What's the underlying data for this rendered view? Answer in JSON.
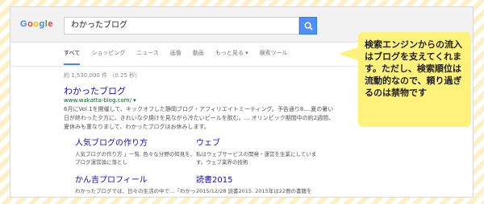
{
  "search": {
    "logo_text": "Google",
    "query": "わかったブログ"
  },
  "tabs": [
    "すべて",
    "ショッピング",
    "ニュース",
    "画像",
    "動画",
    "もっと見る ▾",
    "検索ツール"
  ],
  "result_count": "約 1,530,000 件 （0.25 秒）",
  "result": {
    "title": "わかったブログ",
    "url": "www.wakatta-blog.com/ ▾",
    "snippet": "6月にVol.1を開催して、キックオフした静岡ブログ・アフィリエイトミーティング。予告通り8....夏の暑い日が終わった夕方に、きれいな夕焼けを見ながら冷たいビールを飲む。... オリンピック期間中の約2週間、夏休みも重なりまして、わかったブログはお休みします。"
  },
  "sitelinks": [
    {
      "title": "人気ブログの作り方",
      "text": "人気ブログの作り方 」一覧. 色々な分野の知見を、ブログ運営論に落とし"
    },
    {
      "title": "ウェブ",
      "text": "私はウェブサービスの開発・運営を生業にしています。ウェブ業界の技術"
    },
    {
      "title": "かん吉プロフィール",
      "text": "わかったブログでは、日々の生活の中で…「わかった」と感じた"
    },
    {
      "title": "読書2015",
      "text": "2015/12/28 読書2015. 2015年は22冊の書籍を … 大好きな本を"
    }
  ],
  "callout": {
    "text": "検索エンジンからの流入はブログを支えてくれます。ただし、検索順位は流動的なので、頼り過ぎるのは禁物です"
  }
}
